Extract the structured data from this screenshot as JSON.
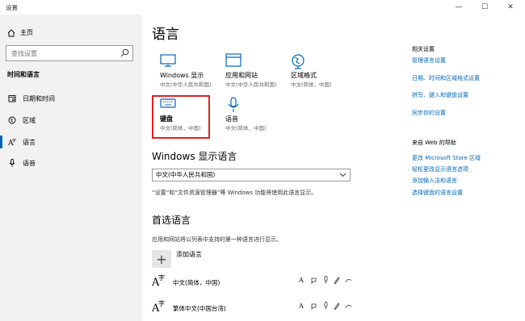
{
  "window": {
    "title": "设置",
    "minimize_glyph": "—",
    "maximize_glyph": "☐",
    "close_glyph": "✕"
  },
  "sidebar": {
    "home_label": "主页",
    "search_placeholder": "查找设置",
    "section_title": "时间和语言",
    "items": [
      {
        "label": "日期和时间",
        "icon": "calendar-icon"
      },
      {
        "label": "区域",
        "icon": "globe-icon"
      },
      {
        "label": "语言",
        "icon": "language-icon",
        "active": true
      },
      {
        "label": "语音",
        "icon": "microphone-icon"
      }
    ]
  },
  "main": {
    "title": "语言",
    "tiles": [
      {
        "label": "Windows 显示",
        "sub": "中文(中华人民共和国)",
        "icon": "monitor-icon"
      },
      {
        "label": "应用和网站",
        "sub": "中文(中华人民共和国)",
        "icon": "window-icon"
      },
      {
        "label": "区域格式",
        "sub": "中文(简体，中国)",
        "icon": "globe-icon"
      },
      {
        "label": "键盘",
        "sub": "中文(简体，中国)",
        "icon": "keyboard-icon",
        "selected": true
      },
      {
        "label": "语音",
        "sub": "中文(简体，中国)",
        "icon": "microphone-icon"
      }
    ],
    "display_language": {
      "heading": "Windows 显示语言",
      "selected": "中文(中华人民共和国)",
      "note": "“设置”和“文件资源管理器”等 Windows 功能将使用此语言显示。"
    },
    "preferred": {
      "heading": "首选语言",
      "note": "应用和网站将以列表中支持的第一种语言进行显示。",
      "add_label": "添加语言",
      "add_glyph": "+",
      "languages": [
        {
          "name": "中文(简体，中国)"
        },
        {
          "name": "繁体中文(中国台湾)"
        }
      ],
      "lang_icon_big": "A",
      "lang_icon_small": "字"
    }
  },
  "related": {
    "heading": "相关设置",
    "links": [
      "管理语言设置",
      "日期、时间和区域格式设置",
      "拼写、键入和键盘设置",
      "同步你的设置"
    ]
  },
  "help": {
    "heading": "来自 Web 的帮助",
    "links": [
      "更改 Microsoft Store 区域",
      "轻松更改显示语言选项",
      "添加输入法和语言",
      "选择键盘的语言设置"
    ]
  },
  "colors": {
    "accent": "#0067b8",
    "selection_border": "#e02020",
    "sidebar_bg": "#f2f2f2"
  }
}
